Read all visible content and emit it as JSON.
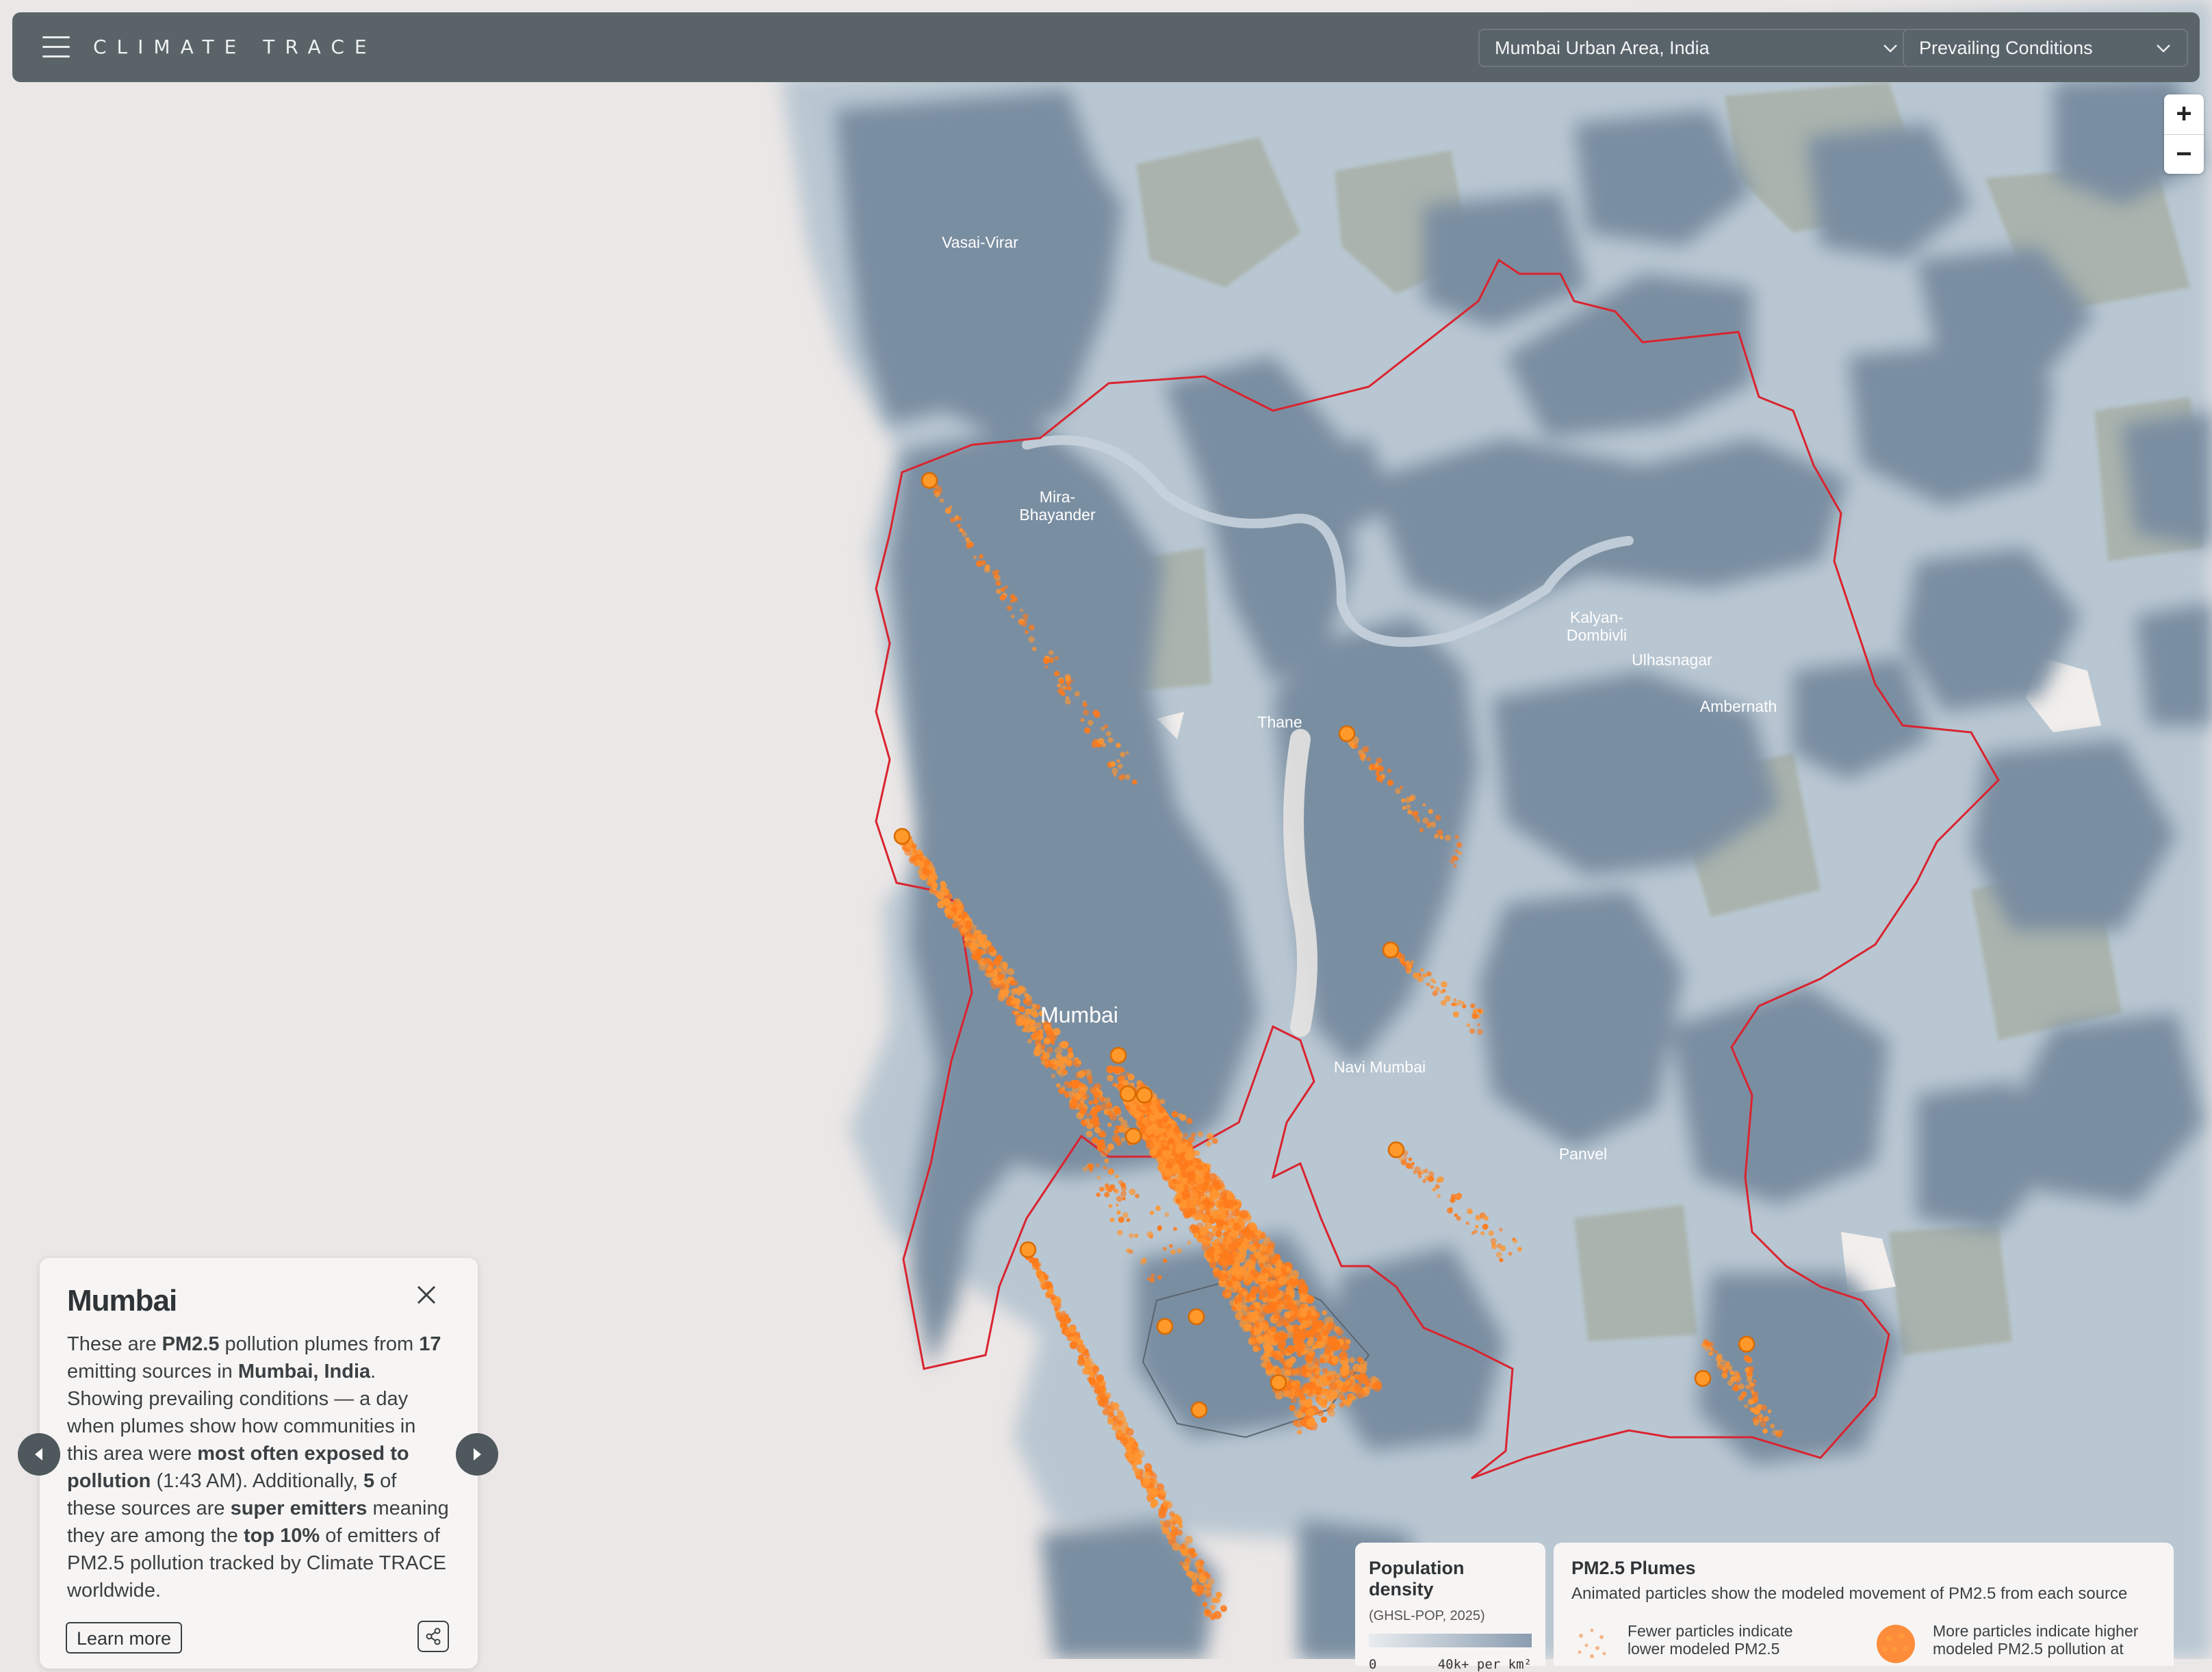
{
  "header": {
    "brand": "CLIMATE TRACE",
    "area_select": "Mumbai Urban Area, India",
    "conditions_select": "Prevailing Conditions"
  },
  "map": {
    "labels": {
      "vasai": "Vasai-Virar",
      "mira_1": "Mira-",
      "mira_2": "Bhayander",
      "kalyan_1": "Kalyan-",
      "kalyan_2": "Dombivli",
      "ulhasnagar": "Ulhasnagar",
      "ambernath": "Ambernath",
      "thane": "Thane",
      "mumbai": "Mumbai",
      "navi_mumbai": "Navi Mumbai",
      "panvel": "Panvel"
    },
    "colors": {
      "urban": "#7b8fa1",
      "land": "#a8b9c6",
      "boundary": "#d9242f",
      "plume": "#ff7a1a"
    }
  },
  "zoom": {
    "in": "+",
    "out": "−"
  },
  "info": {
    "title": "Mumbai",
    "p1": "These are ",
    "b1": "PM2.5",
    "p2": " pollution plumes from ",
    "b2": "17",
    "p3": " emitting sources in ",
    "b3": "Mumbai, India",
    "p4": ". Showing prevailing conditions — a day when plumes show how communities in this area were ",
    "b4": "most often exposed to pollution",
    "p5": " (1:43 AM). Additionally, ",
    "b5": "5",
    "p6": " of these sources are ",
    "b6": "super emitters",
    "p7": " meaning they are among the ",
    "b7": "top 10%",
    "p8": " of emitters of PM2.5 pollution tracked by Climate TRACE worldwide.",
    "learn_more": "Learn more"
  },
  "legend_population": {
    "title": "Population density",
    "subtitle": "(GHSL-POP, 2025)",
    "min": "0",
    "max": "40k+ per km²"
  },
  "legend_plumes": {
    "title": "PM2.5 Plumes",
    "subtitle": "Animated particles show the modeled movement of PM2.5 from each source",
    "fewer_1": "Fewer particles indicate",
    "fewer_2": "lower modeled PM2.5",
    "more_1": "More particles indicate higher",
    "more_2": "modeled PM2.5 pollution at"
  }
}
